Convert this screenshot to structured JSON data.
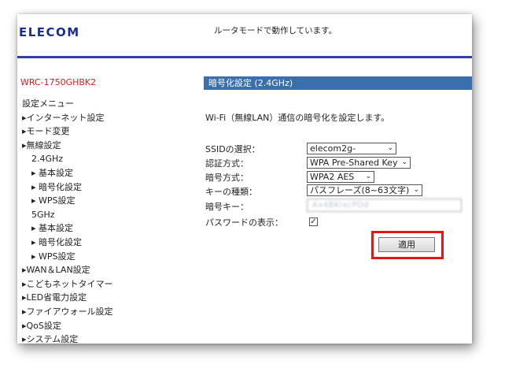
{
  "header": {
    "logo": "ELECOM",
    "mode_message": "ルータモードで動作しています。",
    "model": "WRC-1750GHBK2"
  },
  "menu": {
    "title": "設定メニュー",
    "items": [
      {
        "label": "▸インターネット設定",
        "level": 0
      },
      {
        "label": "▸モード変更",
        "level": 0
      },
      {
        "label": "▸無線設定",
        "level": 0
      },
      {
        "label": "2.4GHz",
        "level": 1
      },
      {
        "label": "▸ 基本設定",
        "level": 2
      },
      {
        "label": "▸ 暗号化設定",
        "level": 2
      },
      {
        "label": "▸ WPS設定",
        "level": 2
      },
      {
        "label": "5GHz",
        "level": 1
      },
      {
        "label": "▸ 基本設定",
        "level": 2
      },
      {
        "label": "▸ 暗号化設定",
        "level": 2
      },
      {
        "label": "▸ WPS設定",
        "level": 2
      },
      {
        "label": "▸WAN＆LAN設定",
        "level": 0
      },
      {
        "label": "▸こどもネットタイマー",
        "level": 0
      },
      {
        "label": "▸LED省電力設定",
        "level": 0
      },
      {
        "label": "▸ファイアウォール設定",
        "level": 0
      },
      {
        "label": "▸QoS設定",
        "level": 0
      },
      {
        "label": "▸システム設定",
        "level": 0
      }
    ]
  },
  "content": {
    "section_title": "暗号化設定 (2.4GHz)",
    "description": "Wi-Fi（無線LAN）通信の暗号化を設定します。",
    "fields": {
      "ssid_label": "SSIDの選択：",
      "ssid_value": "elecom2g-",
      "auth_label": "認証方式：",
      "auth_value": "WPA Pre-Shared Key",
      "enc_label": "暗号方式：",
      "enc_value": "WPA2 AES",
      "keytype_label": "キーの種類：",
      "keytype_value": "パスフレーズ(8~63文字)",
      "key_label": "暗号キー：",
      "key_value": "Ax4BKlxcPDd",
      "show_pw_label": "パスワードの表示：",
      "show_pw_checked": "✓"
    },
    "apply_label": "適用"
  },
  "colors": {
    "logo": "#1a2f8a",
    "header_rule": "#3040a8",
    "model": "#d42020",
    "section_bar": "#3a6fae",
    "highlight": "#e01818"
  }
}
